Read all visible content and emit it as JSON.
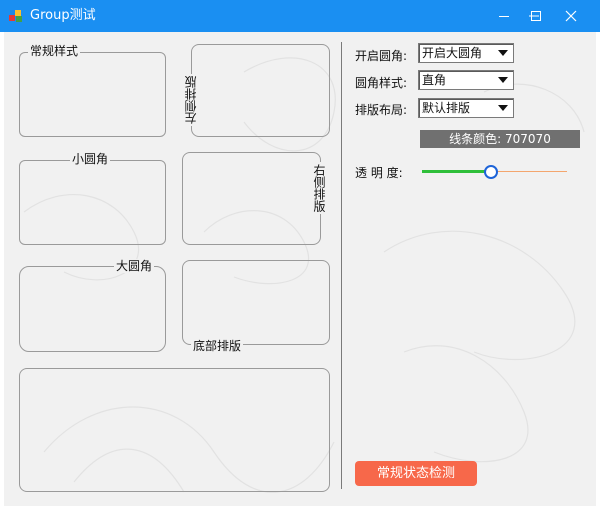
{
  "window": {
    "title": "Group测试"
  },
  "groups": {
    "normal": "常规样式",
    "left": "左侧排版",
    "small_radius": "小圆角",
    "right": "右侧排版",
    "large_radius": "大圆角",
    "bottom": "底部排版"
  },
  "settings": {
    "radius_label": "开启圆角:",
    "radius_value": "开启大圆角",
    "style_label": "圆角样式:",
    "style_value": "直角",
    "layout_label": "排版布局:",
    "layout_value": "默认排版",
    "line_color_text": "线条颜色: 707070",
    "opacity_label": "透 明 度:",
    "opacity_fraction": 0.48
  },
  "button": {
    "label": "常规状态检测"
  },
  "colors": {
    "titlebar": "#1a8ff2",
    "line": "#707070",
    "button": "#f7684a",
    "slider_active": "#2fbf3a",
    "slider_rest": "#f4a66e"
  }
}
